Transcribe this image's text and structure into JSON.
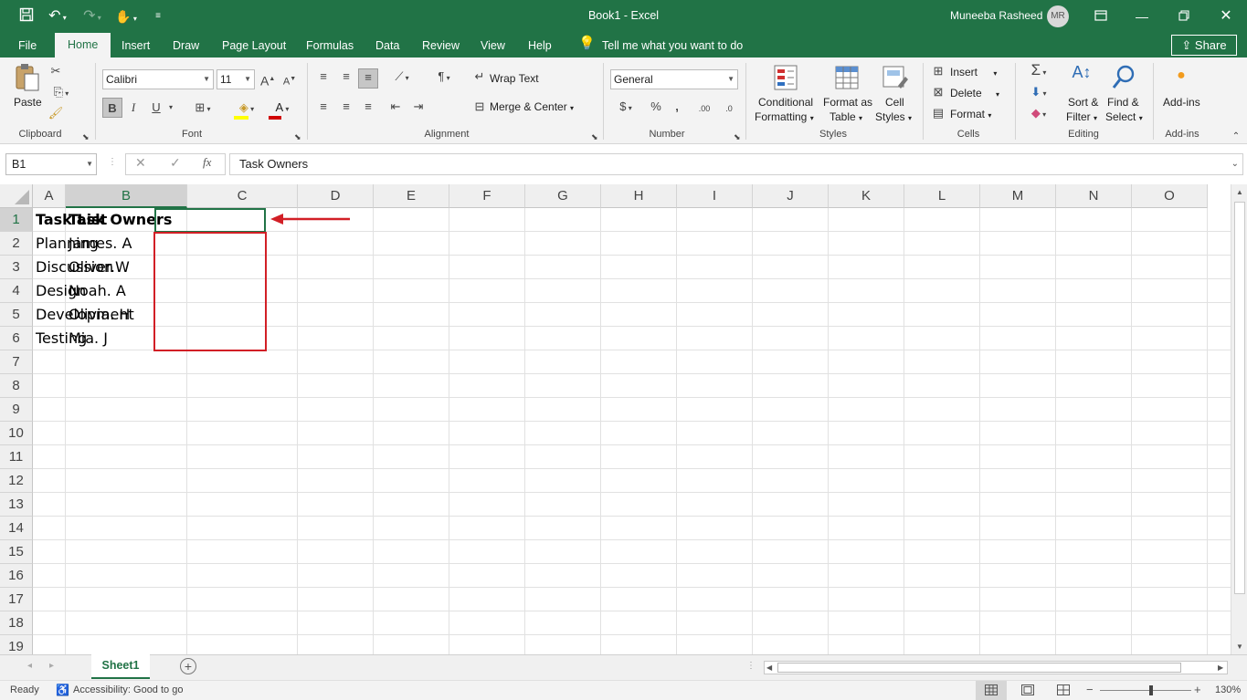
{
  "titlebar": {
    "title": "Book1  -  Excel",
    "user_name": "Muneeba Rasheed",
    "user_initials": "MR"
  },
  "tabs": [
    {
      "label": "File"
    },
    {
      "label": "Home"
    },
    {
      "label": "Insert"
    },
    {
      "label": "Draw"
    },
    {
      "label": "Page Layout"
    },
    {
      "label": "Formulas"
    },
    {
      "label": "Data"
    },
    {
      "label": "Review"
    },
    {
      "label": "View"
    },
    {
      "label": "Help"
    }
  ],
  "tell_me": "Tell me what you want to do",
  "share_label": "Share",
  "ribbon": {
    "clipboard": {
      "paste": "Paste",
      "label": "Clipboard"
    },
    "font": {
      "name": "Calibri",
      "size": "11",
      "label": "Font",
      "bold": "B",
      "italic": "I",
      "underline": "U",
      "grow": "A",
      "shrink": "A"
    },
    "alignment": {
      "wrap": "Wrap Text",
      "merge": "Merge & Center",
      "label": "Alignment"
    },
    "number": {
      "format": "General",
      "label": "Number",
      "percent": "%",
      "comma": ",",
      "inc": ".00",
      "dec": ".0"
    },
    "styles": {
      "conditional_1": "Conditional",
      "conditional_2": "Formatting",
      "format_table_1": "Format as",
      "format_table_2": "Table",
      "cell_styles_1": "Cell",
      "cell_styles_2": "Styles",
      "label": "Styles"
    },
    "cells": {
      "insert": "Insert",
      "delete": "Delete",
      "format": "Format",
      "label": "Cells"
    },
    "editing": {
      "sort_1": "Sort &",
      "sort_2": "Filter",
      "find_1": "Find &",
      "find_2": "Select",
      "label": "Editing"
    },
    "addins": {
      "button": "Add-ins",
      "label": "Add-ins"
    }
  },
  "formula_bar": {
    "name_box": "B1",
    "fx": "fx",
    "value": "Task Owners"
  },
  "columns": [
    "A",
    "B",
    "C",
    "D",
    "E",
    "F",
    "G",
    "H",
    "I",
    "J",
    "K",
    "L",
    "M",
    "N",
    "O"
  ],
  "rows": [
    "1",
    "2",
    "3",
    "4",
    "5",
    "6",
    "7",
    "8",
    "9",
    "10",
    "11",
    "12",
    "13",
    "14",
    "15",
    "16",
    "17",
    "18",
    "19"
  ],
  "cells": {
    "A1": "Task List",
    "B1": "Task Owners",
    "A2": "Planning",
    "B2": "James. A",
    "A3": "Discussion",
    "B3": "Oliver.W",
    "A4": "Design",
    "B4": "Noah. A",
    "A5": "Development",
    "B5": "Olivia. H",
    "A6": "Testing",
    "B6": "Mia. J"
  },
  "sheet_tab": "Sheet1",
  "status": {
    "ready": "Ready",
    "accessibility": "Accessibility: Good to go",
    "zoom": "130%"
  },
  "colors": {
    "excel_green": "#217346",
    "annotation_red": "#d21f26"
  }
}
